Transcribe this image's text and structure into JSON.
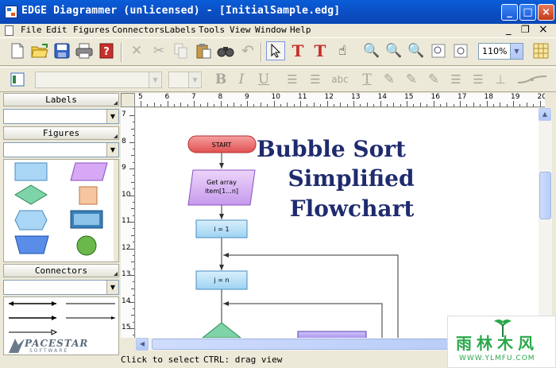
{
  "window": {
    "title": "EDGE Diagrammer (unlicensed) - [InitialSample.edg]"
  },
  "menu": [
    {
      "label": "File"
    },
    {
      "label": "Edit"
    },
    {
      "label": "Figures"
    },
    {
      "label": "Connectors"
    },
    {
      "label": "Labels"
    },
    {
      "label": "Tools"
    },
    {
      "label": "View"
    },
    {
      "label": "Window"
    },
    {
      "label": "Help"
    }
  ],
  "toolbar": {
    "zoom_value": "110%"
  },
  "panels": {
    "labels_header": "Labels",
    "figures_header": "Figures",
    "connectors_header": "Connectors"
  },
  "logo": {
    "name": "PACESTAR",
    "sub": "SOFTWARE"
  },
  "rulers": {
    "h_ticks": [
      "5",
      "6",
      "7",
      "8",
      "9",
      "10",
      "11",
      "12",
      "13",
      "14",
      "15",
      "16",
      "17",
      "18",
      "19",
      "20"
    ],
    "v_ticks": [
      "7",
      "8",
      "9",
      "10",
      "11",
      "12",
      "13",
      "14",
      "15"
    ]
  },
  "diagram": {
    "title_lines": [
      "Bubble Sort",
      "Simplified",
      "Flowchart"
    ],
    "start_label": "START",
    "get_array_label": "Get array item[1...n]",
    "i_label": "i = 1",
    "j_label": "j = n",
    "colors": {
      "title": "#1f2b6e",
      "start_fill": "#f07070",
      "box_fill": "#bde3f7",
      "para_fill": "#d9b3f0",
      "decision_fill": "#7fd3a8"
    }
  },
  "status": {
    "left": "Click to select",
    "right": "CTRL: drag view"
  },
  "watermark": {
    "main": "雨林木风",
    "url": "WWW.YLMFU.COM"
  }
}
